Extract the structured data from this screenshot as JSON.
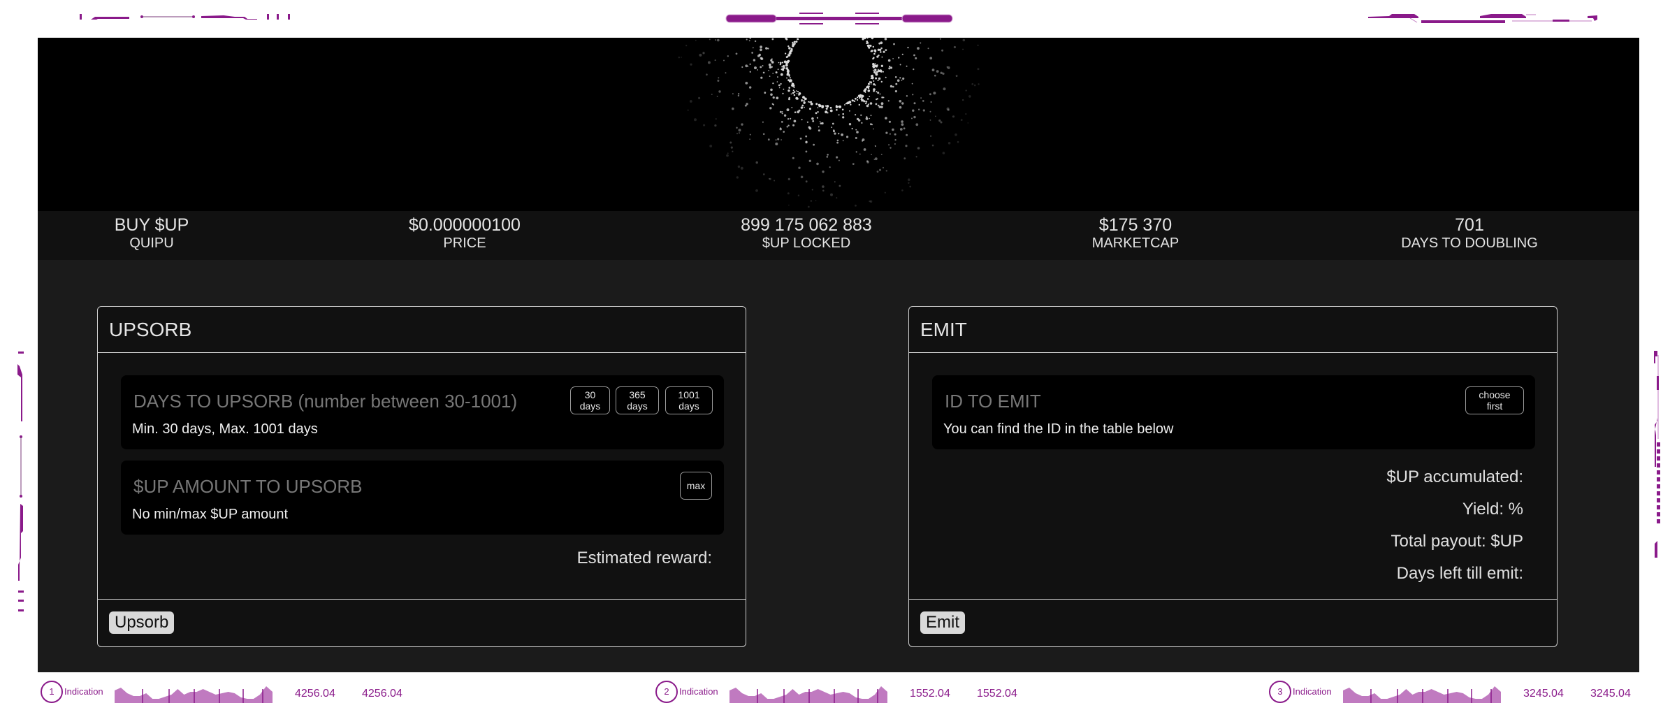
{
  "stats": [
    {
      "value": "BUY $UP",
      "label": "QUIPU"
    },
    {
      "value": "$0.000000100",
      "label": "PRICE"
    },
    {
      "value": "899 175 062 883",
      "label": "$UP LOCKED"
    },
    {
      "value": "$175 370",
      "label": "MARKETCAP"
    },
    {
      "value": "701",
      "label": "DAYS TO DOUBLING"
    }
  ],
  "upsorb": {
    "title": "UPSORB",
    "days_field": {
      "placeholder": "DAYS TO UPSORB (number between 30-1001)",
      "hint": "Min. 30 days, Max. 1001 days",
      "presets": [
        {
          "top": "30",
          "bottom": "days"
        },
        {
          "top": "365",
          "bottom": "days"
        },
        {
          "top": "1001",
          "bottom": "days"
        }
      ]
    },
    "amount_field": {
      "placeholder": "$UP AMOUNT TO UPSORB",
      "hint": "No min/max $UP amount",
      "max_label": "max"
    },
    "estimated_reward": "Estimated reward:",
    "button": "Upsorb"
  },
  "emit": {
    "title": "EMIT",
    "id_field": {
      "placeholder": "ID TO EMIT",
      "hint": "You can find the ID in the table below",
      "choose_top": "choose",
      "choose_bottom": "first"
    },
    "info": [
      "$UP accumulated:",
      "Yield: %",
      "Total payout: $UP",
      "Days left till emit:"
    ],
    "button": "Emit"
  },
  "indicators": [
    {
      "number": "1",
      "label": "Indication",
      "value1": "4256.04",
      "value2": "4256.04"
    },
    {
      "number": "2",
      "label": "Indication",
      "value1": "1552.04",
      "value2": "1552.04"
    },
    {
      "number": "3",
      "label": "Indication",
      "value1": "3245.04",
      "value2": "3245.04"
    }
  ],
  "colors": {
    "accent": "#8a1a8a",
    "spark_fill": "#c07ac0",
    "panel_bg": "#111111",
    "page_bg": "#1b1b1b"
  }
}
